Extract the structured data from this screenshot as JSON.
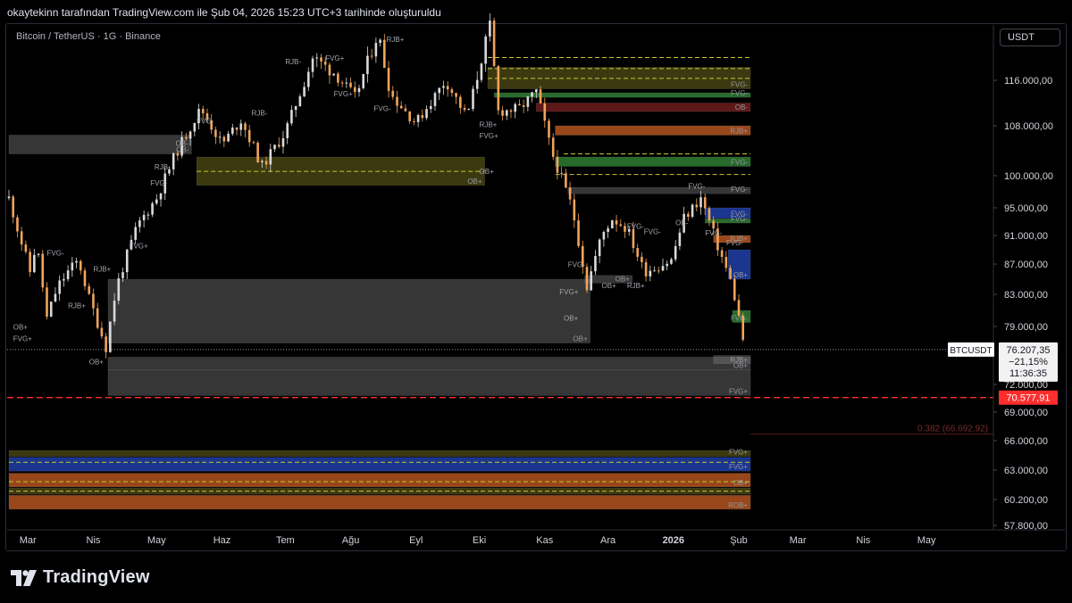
{
  "header": {
    "credit": "okaytekinn tarafından TradingView.com ile Şub 04, 2026 15:23 UTC+3 tarihinde oluşturuldu",
    "symbol_line": "Bitcoin / TetherUS · 1G · Binance",
    "currency_button": "USDT"
  },
  "footer": {
    "brand": "TradingView"
  },
  "colors": {
    "background": "#000000",
    "candle_up": "#d9d9d9",
    "candle_down": "#f0a45c",
    "price_line_red": "#ff2e2e",
    "fvg_green": "#2e7d32",
    "fvg_blue": "#1f3fa8",
    "rjb_orange": "#b3541e",
    "ob_gray": "#4a4a4a",
    "olive": "#5e5a1f"
  },
  "chart_data": {
    "type": "candlestick",
    "title": "Bitcoin / TetherUS · 1G · Binance",
    "y_range": [
      57800,
      121500
    ],
    "y_ticks": [
      "116.000,00",
      "108.000,00",
      "100.000,00",
      "95.000,00",
      "91.000,00",
      "87.000,00",
      "83.000,00",
      "79.000,00",
      "72.000,00",
      "69.000,00",
      "66.000,00",
      "63.000,00",
      "60.200,00",
      "57.800,00"
    ],
    "y_tick_values": [
      116000,
      108000,
      100000,
      95000,
      91000,
      87000,
      83000,
      79000,
      72000,
      69000,
      66000,
      63000,
      60200,
      57800
    ],
    "x_labels": [
      "Mar",
      "Nis",
      "May",
      "Haz",
      "Tem",
      "Ağu",
      "Eyl",
      "Eki",
      "Kas",
      "Ara",
      "2026",
      "Şub",
      "Mar",
      "Nis",
      "May"
    ],
    "x_label_dates": [
      "2025-03-01",
      "2025-04-01",
      "2025-05-01",
      "2025-06-01",
      "2025-07-01",
      "2025-08-01",
      "2025-09-01",
      "2025-10-01",
      "2025-11-01",
      "2025-12-01",
      "2026-01-01",
      "2026-02-01",
      "2026-03-01",
      "2026-04-01",
      "2026-05-01"
    ],
    "x_range": [
      "2025-02-20",
      "2026-05-31"
    ],
    "path_points": [
      [
        "2025-02-20",
        96500
      ],
      [
        "2025-02-25",
        91000
      ],
      [
        "2025-03-02",
        86000
      ],
      [
        "2025-03-05",
        90000
      ],
      [
        "2025-03-10",
        80000
      ],
      [
        "2025-03-15",
        84000
      ],
      [
        "2025-03-20",
        86000
      ],
      [
        "2025-03-25",
        87500
      ],
      [
        "2025-03-30",
        82500
      ],
      [
        "2025-04-07",
        76500
      ],
      [
        "2025-04-12",
        84000
      ],
      [
        "2025-04-22",
        92500
      ],
      [
        "2025-05-01",
        96500
      ],
      [
        "2025-05-10",
        103500
      ],
      [
        "2025-05-22",
        111000
      ],
      [
        "2025-06-01",
        105000
      ],
      [
        "2025-06-10",
        109000
      ],
      [
        "2025-06-20",
        101500
      ],
      [
        "2025-07-01",
        107000
      ],
      [
        "2025-07-14",
        119500
      ],
      [
        "2025-07-25",
        117000
      ],
      [
        "2025-08-03",
        113000
      ],
      [
        "2025-08-14",
        123500
      ],
      [
        "2025-08-20",
        113500
      ],
      [
        "2025-09-01",
        108500
      ],
      [
        "2025-09-15",
        116000
      ],
      [
        "2025-09-25",
        109500
      ],
      [
        "2025-10-06",
        125000
      ],
      [
        "2025-10-10",
        110500
      ],
      [
        "2025-10-20",
        111000
      ],
      [
        "2025-10-28",
        114000
      ],
      [
        "2025-11-04",
        104000
      ],
      [
        "2025-11-14",
        95000
      ],
      [
        "2025-11-21",
        84000
      ],
      [
        "2025-11-28",
        91000
      ],
      [
        "2025-12-03",
        93500
      ],
      [
        "2025-12-10",
        92000
      ],
      [
        "2025-12-18",
        86000
      ],
      [
        "2025-12-31",
        87500
      ],
      [
        "2026-01-06",
        93500
      ],
      [
        "2026-01-14",
        96500
      ],
      [
        "2026-01-22",
        89500
      ],
      [
        "2026-01-29",
        84000
      ],
      [
        "2026-02-04",
        76207.35
      ]
    ],
    "last_price": {
      "symbol": "BTCUSDT",
      "price": "76.207,35",
      "change": "−21,15%",
      "countdown": "11:36:35",
      "value": 76207.35
    },
    "red_level": {
      "label": "70.577,91",
      "value": 70577.91
    },
    "fib_level": {
      "label": "0.382 (66.692,92)",
      "value": 66692.92
    },
    "zones": [
      {
        "label": "OB-",
        "from": "2025-02-20",
        "to": "2025-05-15",
        "top": 106500,
        "bottom": 103500,
        "kind": "ob"
      },
      {
        "label": "OB+",
        "from": "2025-05-20",
        "to": "2025-10-01",
        "top": 103000,
        "bottom": 98500,
        "kind": "olive"
      },
      {
        "label": "OB+",
        "from": "2025-04-08",
        "to": "2025-11-20",
        "top": 85000,
        "bottom": 77000,
        "kind": "ob"
      },
      {
        "label": "OB+",
        "from": "2025-04-08",
        "to": "2026-02-04",
        "top": 75300,
        "bottom": 73800,
        "kind": "ob"
      },
      {
        "label": "FVG+",
        "from": "2025-04-08",
        "to": "2026-02-04",
        "top": 73800,
        "bottom": 70800,
        "kind": "ob"
      },
      {
        "label": "RJB+",
        "from": "2026-01-20",
        "to": "2026-02-04",
        "top": 75500,
        "bottom": 74500,
        "kind": "ob"
      },
      {
        "label": "FVG-",
        "from": "2025-10-05",
        "to": "2026-02-04",
        "top": 118000,
        "bottom": 114500,
        "kind": "olive"
      },
      {
        "label": "FVG-",
        "from": "2025-10-08",
        "to": "2026-02-04",
        "top": 113800,
        "bottom": 113000,
        "kind": "green"
      },
      {
        "label": "OB-",
        "from": "2025-10-28",
        "to": "2026-02-04",
        "top": 112000,
        "bottom": 110500,
        "kind": "maroon"
      },
      {
        "label": "RJB+",
        "from": "2025-11-06",
        "to": "2026-02-04",
        "top": 108000,
        "bottom": 106500,
        "kind": "orange"
      },
      {
        "label": "FVG-",
        "from": "2025-11-06",
        "to": "2026-02-04",
        "top": 103000,
        "bottom": 101500,
        "kind": "green"
      },
      {
        "label": "FVG-",
        "from": "2025-11-12",
        "to": "2026-02-04",
        "top": 98200,
        "bottom": 97200,
        "kind": "ob"
      },
      {
        "label": "FVG-",
        "from": "2026-01-16",
        "to": "2026-02-04",
        "top": 95000,
        "bottom": 93500,
        "kind": "blue"
      },
      {
        "label": "FVG-",
        "from": "2026-01-16",
        "to": "2026-02-04",
        "top": 93400,
        "bottom": 92800,
        "kind": "green"
      },
      {
        "label": "RJB+",
        "from": "2026-01-20",
        "to": "2026-02-04",
        "top": 91000,
        "bottom": 90000,
        "kind": "orange"
      },
      {
        "label": "OB+",
        "from": "2026-01-27",
        "to": "2026-02-04",
        "top": 89000,
        "bottom": 85000,
        "kind": "blue"
      },
      {
        "label": "FVG-",
        "from": "2026-01-29",
        "to": "2026-02-04",
        "top": 81000,
        "bottom": 79500,
        "kind": "green"
      },
      {
        "label": "OB+",
        "from": "2025-11-20",
        "to": "2025-12-10",
        "top": 85500,
        "bottom": 84500,
        "kind": "ob"
      },
      {
        "label": "FVG+",
        "from": "2025-02-20",
        "to": "2026-02-04",
        "top": 65000,
        "bottom": 64400,
        "kind": "olive"
      },
      {
        "label": "FVG+",
        "from": "2025-02-20",
        "to": "2026-02-04",
        "top": 64300,
        "bottom": 62900,
        "kind": "blue"
      },
      {
        "label": "OB+",
        "from": "2025-02-20",
        "to": "2026-02-04",
        "top": 62700,
        "bottom": 61400,
        "kind": "orange"
      },
      {
        "label": "",
        "from": "2025-02-20",
        "to": "2026-02-04",
        "top": 61300,
        "bottom": 60700,
        "kind": "olive"
      },
      {
        "label": "ROB+",
        "from": "2025-02-20",
        "to": "2026-02-04",
        "top": 60600,
        "bottom": 59300,
        "kind": "orange"
      }
    ],
    "level_lines": [
      {
        "from": "2025-10-05",
        "to": "2026-02-04",
        "value": 119500,
        "color": "#c8c832",
        "style": "dashed"
      },
      {
        "from": "2025-10-05",
        "to": "2026-02-04",
        "value": 117800,
        "color": "#c8c832",
        "style": "dashed"
      },
      {
        "from": "2025-10-05",
        "to": "2026-02-04",
        "value": 116300,
        "color": "#c8c832",
        "style": "dashed"
      },
      {
        "from": "2025-05-20",
        "to": "2025-10-01",
        "value": 100700,
        "color": "#c8c832",
        "style": "dashed"
      },
      {
        "from": "2025-11-10",
        "to": "2026-02-04",
        "value": 103500,
        "color": "#c8c832",
        "style": "dashed"
      },
      {
        "from": "2025-11-06",
        "to": "2026-02-04",
        "value": 100200,
        "color": "#c8c832",
        "style": "dashed"
      },
      {
        "from": "2025-02-20",
        "to": "2026-02-04",
        "value": 63800,
        "color": "#c8c832",
        "style": "dashed"
      },
      {
        "from": "2025-02-20",
        "to": "2026-02-04",
        "value": 61900,
        "color": "#c8c832",
        "style": "dashed"
      },
      {
        "from": "2025-02-20",
        "to": "2026-02-04",
        "value": 61000,
        "color": "#c8c832",
        "style": "dashed"
      }
    ],
    "annotations": [
      {
        "text": "RJB+",
        "date": "2025-08-18",
        "value": 122000
      },
      {
        "text": "FVG+",
        "date": "2025-07-20",
        "value": 119000
      },
      {
        "text": "RJB-",
        "date": "2025-07-01",
        "value": 118500
      },
      {
        "text": "FVG+",
        "date": "2025-07-24",
        "value": 113200
      },
      {
        "text": "FVG-",
        "date": "2025-08-12",
        "value": 110600
      },
      {
        "text": "RJB-",
        "date": "2025-06-15",
        "value": 109800
      },
      {
        "text": "FVG-",
        "date": "2025-05-20",
        "value": 108400
      },
      {
        "text": "OB-",
        "date": "2025-05-10",
        "value": 104800
      },
      {
        "text": "RJB-",
        "date": "2025-04-30",
        "value": 101000
      },
      {
        "text": "FVG-",
        "date": "2025-04-28",
        "value": 98500
      },
      {
        "text": "FVG+",
        "date": "2025-04-18",
        "value": 89200
      },
      {
        "text": "FVG-",
        "date": "2025-03-10",
        "value": 88200
      },
      {
        "text": "RJB+",
        "date": "2025-04-01",
        "value": 86000
      },
      {
        "text": "RJB+",
        "date": "2025-03-20",
        "value": 81300
      },
      {
        "text": "OB+",
        "date": "2025-02-22",
        "value": 78600
      },
      {
        "text": "FVG+",
        "date": "2025-02-22",
        "value": 77200
      },
      {
        "text": "OB+",
        "date": "2025-03-30",
        "value": 74400
      },
      {
        "text": "RJB+",
        "date": "2025-10-01",
        "value": 107800
      },
      {
        "text": "FVG+",
        "date": "2025-10-01",
        "value": 106000
      },
      {
        "text": "OB+",
        "date": "2025-10-01",
        "value": 100300
      },
      {
        "text": "OB+",
        "date": "2025-11-10",
        "value": 79700
      },
      {
        "text": "FVG+",
        "date": "2025-11-08",
        "value": 83000
      },
      {
        "text": "FVG-",
        "date": "2025-11-12",
        "value": 86600
      },
      {
        "text": "OB+",
        "date": "2025-11-28",
        "value": 83800
      },
      {
        "text": "RJB+",
        "date": "2025-12-10",
        "value": 83800
      },
      {
        "text": "FVG-",
        "date": "2025-12-18",
        "value": 91200
      },
      {
        "text": "FVG-",
        "date": "2026-01-08",
        "value": 98000
      },
      {
        "text": "FVG-",
        "date": "2026-01-26",
        "value": 89600
      },
      {
        "text": "FVG-",
        "date": "2025-12-10",
        "value": 92000
      },
      {
        "text": "FVG-",
        "date": "2026-01-16",
        "value": 91000
      },
      {
        "text": "OB-",
        "date": "2026-01-02",
        "value": 92500
      }
    ]
  }
}
